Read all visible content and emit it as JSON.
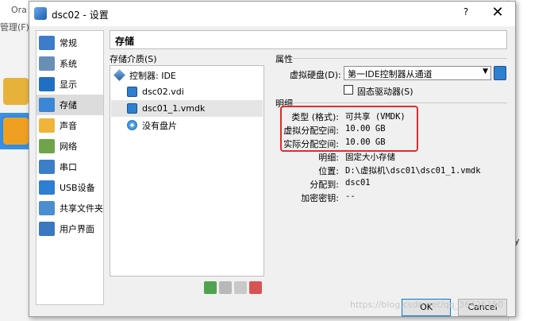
{
  "background": {
    "app_name": "Ora",
    "menu": "管理(F)",
    "right_text": "y"
  },
  "watermark": "https://blog.csdn.net/qq_36426150",
  "dialog": {
    "title": "dsc02 - 设置",
    "help": "?",
    "close": "✕"
  },
  "nav": {
    "items": [
      {
        "label": "常规",
        "color": "#3d7cc9"
      },
      {
        "label": "系统",
        "color": "#6a8fb5"
      },
      {
        "label": "显示",
        "color": "#1f6fc4"
      },
      {
        "label": "存储",
        "color": "#3b86d6"
      },
      {
        "label": "声音",
        "color": "#f0b43a"
      },
      {
        "label": "网络",
        "color": "#6fa54a"
      },
      {
        "label": "串口",
        "color": "#3c7fc7"
      },
      {
        "label": "USB设备",
        "color": "#2e7ed2"
      },
      {
        "label": "共享文件夹",
        "color": "#4b8ecf"
      },
      {
        "label": "用户界面",
        "color": "#3a78c2"
      }
    ],
    "selected_index": 3
  },
  "page": {
    "title": "存储"
  },
  "storage": {
    "media_label": "存储介质(S)",
    "tree": [
      {
        "label": "控制器: IDE",
        "type": "controller"
      },
      {
        "label": "dsc02.vdi",
        "type": "hdd"
      },
      {
        "label": "dsc01_1.vmdk",
        "type": "hdd",
        "selected": true
      },
      {
        "label": "没有盘片",
        "type": "cd"
      }
    ]
  },
  "attributes": {
    "section_label": "属性",
    "hard_disk_label": "虚拟硬盘(D):",
    "hard_disk_value": "第一IDE控制器从通道",
    "ssd_label": "固态驱动器(S)"
  },
  "details": {
    "section_label": "明细",
    "rows": [
      {
        "key": "类型 (格式):",
        "value": "可共享  (VMDK)"
      },
      {
        "key": "虚拟分配空间:",
        "value": "10.00  GB"
      },
      {
        "key": "实际分配空间:",
        "value": "10.00  GB"
      },
      {
        "key": "明细:",
        "value": "固定大小存储"
      },
      {
        "key": "位置:",
        "value": "D:\\虚拟机\\dsc01\\dsc01_1.vmdk"
      },
      {
        "key": "分配到:",
        "value": "dsc01"
      },
      {
        "key": "加密密钥:",
        "value": "--"
      }
    ]
  },
  "buttons": {
    "ok": "OK",
    "cancel": "Cancel"
  }
}
